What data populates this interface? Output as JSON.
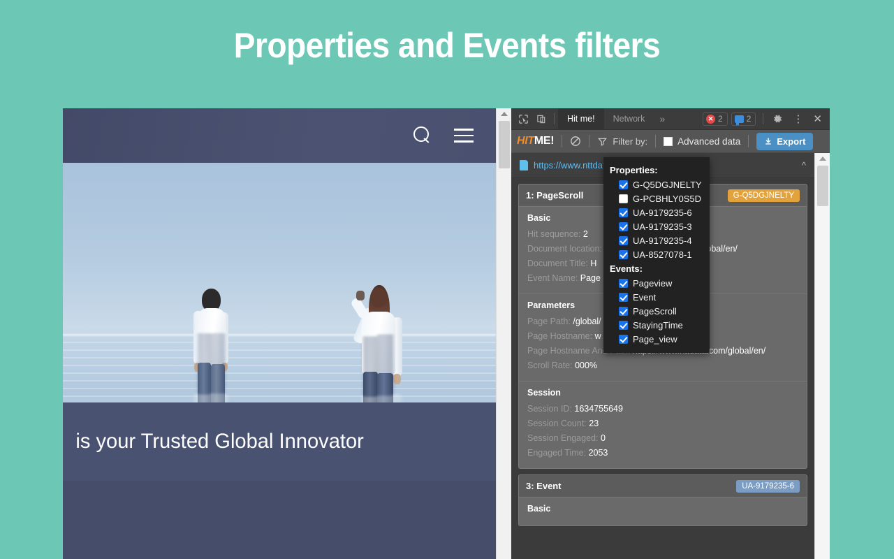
{
  "slide": {
    "title": "Properties and Events filters",
    "background_color": "#6cc7b4"
  },
  "website": {
    "header": {
      "search_icon": "search-icon",
      "menu_icon": "hamburger-menu-icon"
    },
    "hero_caption": "is your Trusted Global Innovator"
  },
  "devtools": {
    "tabbar": {
      "inspect_icon": "inspect-element-icon",
      "device_icon": "device-toolbar-icon",
      "tabs": [
        {
          "label": "Hit me!",
          "active": true
        },
        {
          "label": "Network",
          "active": false
        }
      ],
      "more_tabs": "»",
      "error_badge": {
        "icon": "error-icon",
        "count": "2",
        "color": "#e54b4b"
      },
      "message_badge": {
        "icon": "message-icon",
        "count": "2",
        "color": "#3b8de0"
      },
      "settings_icon": "gear-icon",
      "kebab_icon": "more-options-icon",
      "close_icon": "close-icon"
    },
    "toolbar": {
      "logo_hit": "HIT",
      "logo_me": "ME!",
      "clear_icon": "clear-icon",
      "filter_icon": "filter-funnel-icon",
      "filter_label": "Filter by:",
      "advanced_data_label": "Advanced data",
      "advanced_data_checked": false,
      "export_label": "Export",
      "export_icon": "download-icon",
      "export_color": "#4a90c4"
    },
    "filter_menu": {
      "properties_label": "Properties:",
      "properties": [
        {
          "label": "G-Q5DGJNELTY",
          "checked": true
        },
        {
          "label": "G-PCBHLY0S5D",
          "checked": false
        },
        {
          "label": "UA-9179235-6",
          "checked": true
        },
        {
          "label": "UA-9179235-3",
          "checked": true
        },
        {
          "label": "UA-9179235-4",
          "checked": true
        },
        {
          "label": "UA-8527078-1",
          "checked": true
        }
      ],
      "events_label": "Events:",
      "events": [
        {
          "label": "Pageview",
          "checked": true
        },
        {
          "label": "Event",
          "checked": true
        },
        {
          "label": "PageScroll",
          "checked": true
        },
        {
          "label": "StayingTime",
          "checked": true
        },
        {
          "label": "Page_view",
          "checked": true
        }
      ],
      "checked_color": "#1a73e8"
    },
    "url_bar": {
      "file_icon": "document-icon",
      "url": "https://www.nttdata.com/global/en/",
      "collapse_icon": "chevron-up-icon"
    },
    "hits": [
      {
        "title": "1: PageScroll",
        "pill": "G-Q5DGJNELTY",
        "pill_style": "amber",
        "sections": [
          {
            "title": "Basic",
            "rows": [
              {
                "k": "Hit sequence:",
                "v": "2"
              },
              {
                "k": "Document location:",
                "v": "https://www.nttdata.com/global/en/"
              },
              {
                "k": "Document Title:",
                "v": "H"
              },
              {
                "k": "Event Name:",
                "v": "Page"
              }
            ]
          },
          {
            "title": "Parameters",
            "rows": [
              {
                "k": "Page Path:",
                "v": "/global/"
              },
              {
                "k": "Page Hostname:",
                "v": "w"
              },
              {
                "k": "Page Hostname And Path:",
                "v": "https://www.nttdata.com/global/en/"
              },
              {
                "k": "Scroll Rate:",
                "v": "000%"
              }
            ]
          },
          {
            "title": "Session",
            "rows": [
              {
                "k": "Session ID:",
                "v": "1634755649"
              },
              {
                "k": "Session Count:",
                "v": "23"
              },
              {
                "k": "Session Engaged:",
                "v": "0"
              },
              {
                "k": "Engaged Time:",
                "v": "2053"
              }
            ]
          }
        ]
      },
      {
        "title": "3: Event",
        "pill": "UA-9179235-6",
        "pill_style": "blue",
        "sections": [
          {
            "title": "Basic",
            "rows": []
          }
        ]
      }
    ]
  }
}
